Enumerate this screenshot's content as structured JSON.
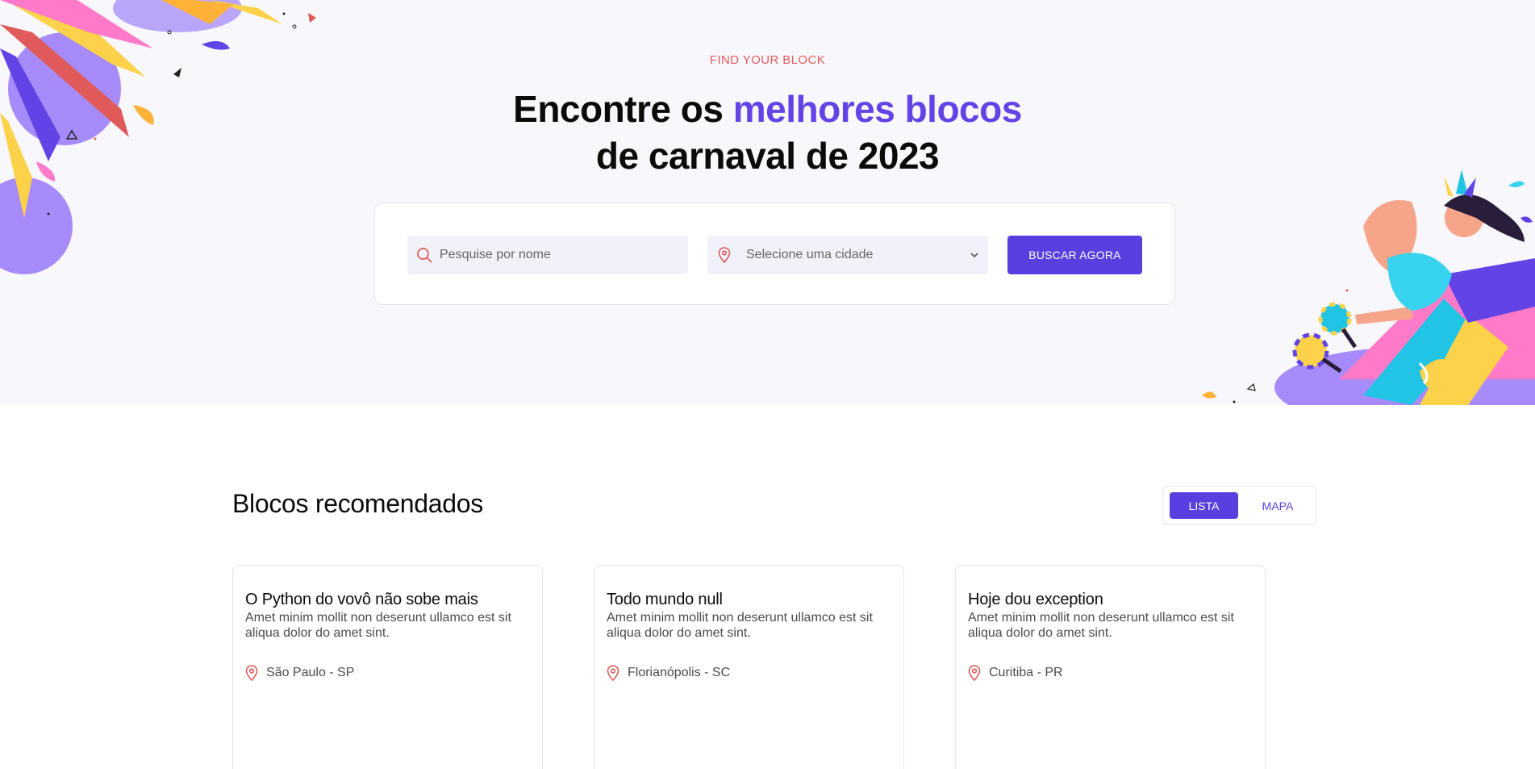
{
  "hero": {
    "eyebrow": "FIND YOUR BLOCK",
    "headline_line1_prefix": "Encontre os ",
    "headline_line1_accent": "melhores blocos",
    "headline_line2": "de carnaval de 2023"
  },
  "search": {
    "name_placeholder": "Pesquise por nome",
    "city_placeholder": "Selecione uma cidade",
    "submit_label": "BUSCAR AGORA"
  },
  "recommended": {
    "title": "Blocos recomendados",
    "view_toggle": {
      "list_label": "LISTA",
      "map_label": "MAPA",
      "selected": "LISTA"
    },
    "cards": [
      {
        "title": "O Python do vovô não sobe mais",
        "description": "Amet minim mollit non deserunt ullamco est sit aliqua dolor do amet sint.",
        "location": "São Paulo - SP"
      },
      {
        "title": "Todo mundo null",
        "description": "Amet minim mollit non deserunt ullamco est sit aliqua dolor do amet sint.",
        "location": "Florianópolis - SC"
      },
      {
        "title": "Hoje dou exception",
        "description": "Amet minim mollit non deserunt ullamco est sit aliqua dolor do amet sint.",
        "location": "Curitiba - PR"
      }
    ]
  },
  "colors": {
    "accent_purple": "#5a3fe0",
    "headline_accent": "#6244e6",
    "eyebrow_red": "#e05a5a",
    "pin_red": "#e05a5a",
    "hero_bg": "#f8f8fc"
  },
  "icons": {
    "search_field": "search-icon",
    "city_field": "map-pin-icon",
    "city_dropdown": "chevron-down-icon",
    "card_location": "map-pin-icon"
  }
}
